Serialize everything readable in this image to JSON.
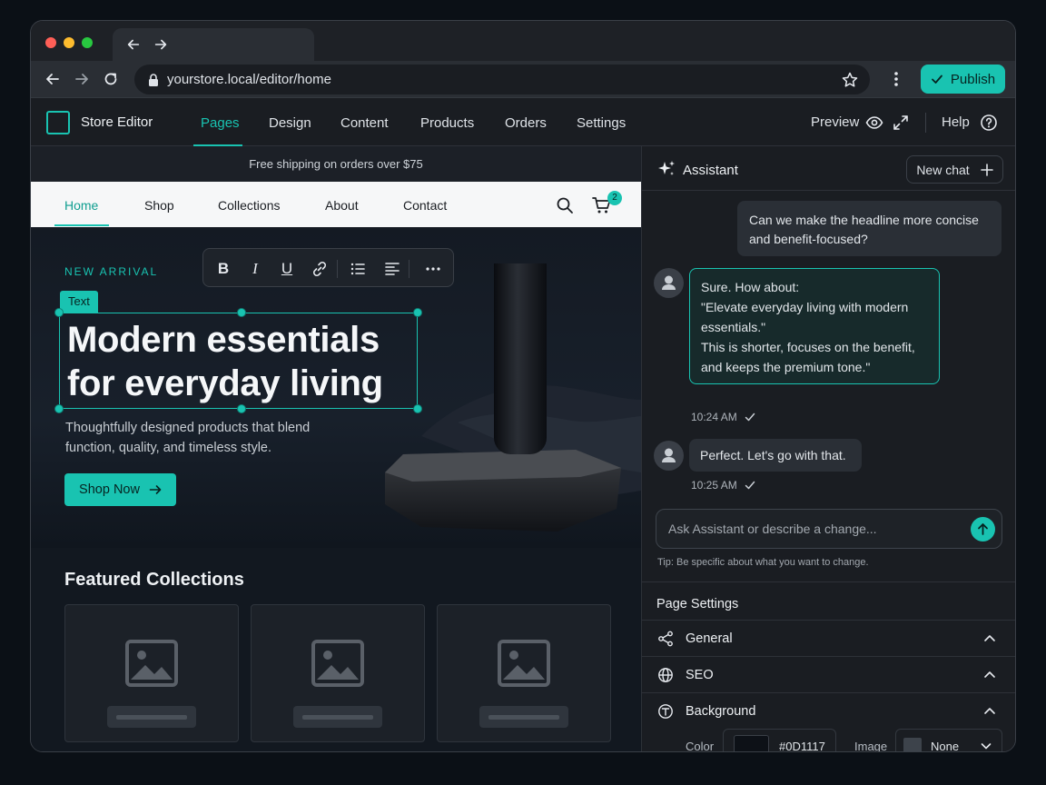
{
  "browser": {
    "url": "yourstore.local/editor/home",
    "publish_label": "Publish"
  },
  "app": {
    "brand": "Store Editor",
    "menu": [
      "Pages",
      "Design",
      "Content",
      "Products",
      "Orders",
      "Settings"
    ],
    "active_menu": "Pages",
    "preview_label": "Preview",
    "help_label": "Help"
  },
  "canvas": {
    "promo": "Free shipping on orders over $75",
    "site_nav": [
      "Home",
      "Shop",
      "Collections",
      "About",
      "Contact"
    ],
    "active_nav": "Home",
    "cart_count": "2",
    "hero": {
      "eyebrow": "NEW ARRIVAL",
      "selection_tag": "Text",
      "headline": "Modern essentials for everyday living",
      "subtext": "Thoughtfully designed products that blend function, quality, and timeless style.",
      "cta": "Shop Now"
    },
    "featured_title": "Featured Collections"
  },
  "assistant": {
    "title": "Assistant",
    "new_chat_label": "New chat",
    "messages": [
      {
        "role": "user",
        "text": "Can we make the headline more concise and benefit-focused?"
      },
      {
        "role": "assistant",
        "lines": [
          "Sure. How about:",
          "\"Elevate everyday living with modern",
          "essentials.\"",
          "This is shorter, focuses on the benefit,",
          "and keeps the premium tone.\""
        ],
        "time": "10:24 AM"
      },
      {
        "role": "assistant",
        "text": "Perfect. Let's go with that.",
        "time": "10:25 AM"
      }
    ],
    "input_placeholder": "Ask Assistant or describe a change...",
    "tip": "Tip: Be specific about what you want to change."
  },
  "page_settings": {
    "title": "Page Settings",
    "sections": [
      "General",
      "SEO",
      "Background"
    ],
    "background": {
      "color_label": "Color",
      "color_value": "#0D1117",
      "image_label": "Image",
      "image_value": "None"
    }
  },
  "colors": {
    "accent": "#19c3b1",
    "background": "#0D1117"
  }
}
